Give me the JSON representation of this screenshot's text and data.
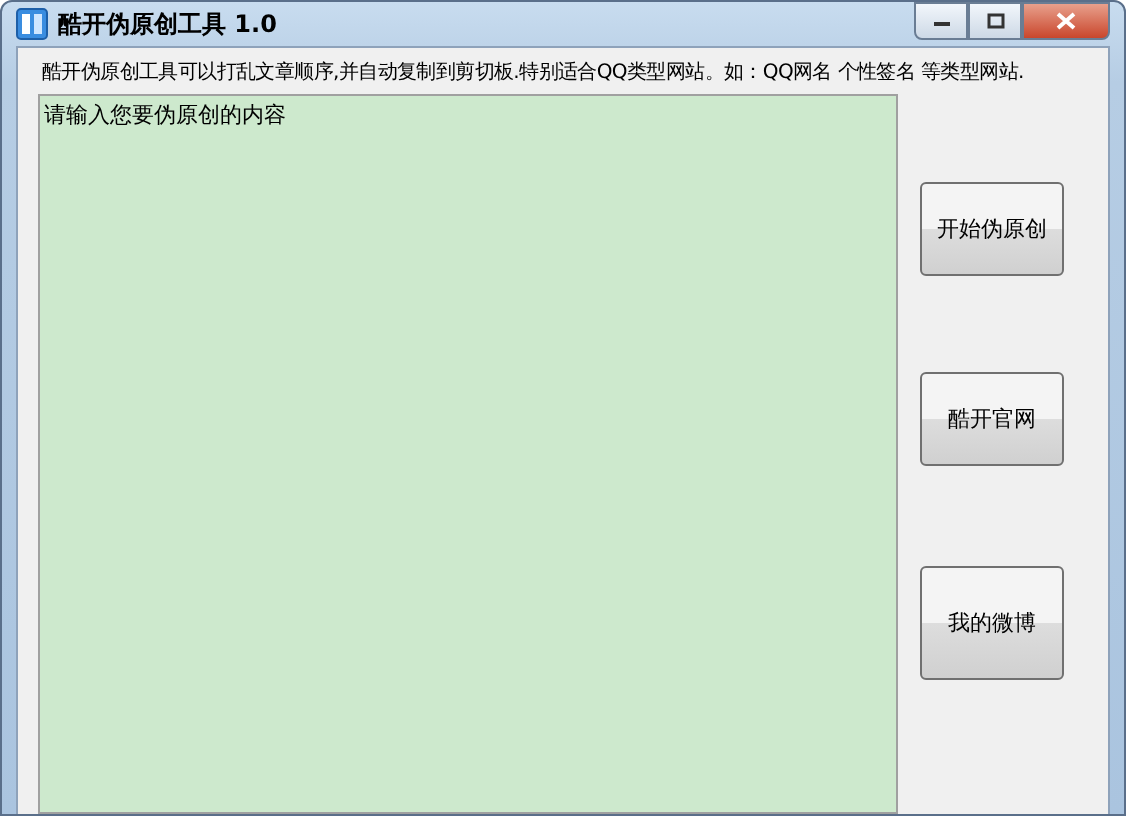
{
  "window": {
    "title": "酷开伪原创工具 1.0"
  },
  "description": "酷开伪原创工具可以打乱文章顺序,并自动复制到剪切板.特别适合QQ类型网站。如：QQ网名 个性签名 等类型网站.",
  "editor": {
    "value": "请输入您要伪原创的内容"
  },
  "buttons": [
    {
      "label": "开始伪原创"
    },
    {
      "label": "酷开官网"
    },
    {
      "label": "我的微博"
    }
  ]
}
